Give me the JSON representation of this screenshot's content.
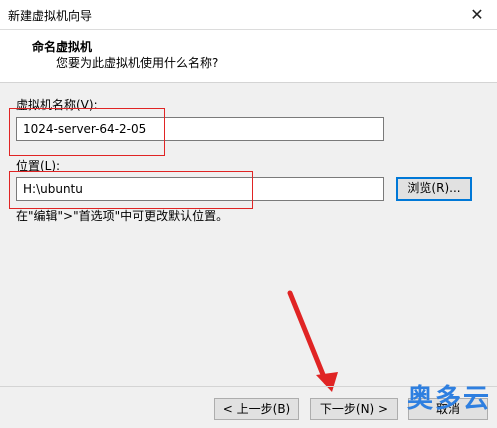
{
  "window": {
    "title": "新建虚拟机向导"
  },
  "header": {
    "title": "命名虚拟机",
    "subtitle": "您要为此虚拟机使用什么名称?"
  },
  "form": {
    "name_label": "虚拟机名称(V):",
    "name_value": "1024-server-64-2-05",
    "location_label": "位置(L):",
    "location_value": "H:\\ubuntu",
    "browse_label": "浏览(R)...",
    "hint": "在\"编辑\">\"首选项\"中可更改默认位置。"
  },
  "footer": {
    "back_label": "< 上一步(B)",
    "next_label": "下一步(N) >",
    "cancel_label": "取消"
  },
  "watermark": "奥多云",
  "colors": {
    "annotation": "#e02424",
    "watermark": "#2e7fe0",
    "focus": "#0078d7"
  }
}
